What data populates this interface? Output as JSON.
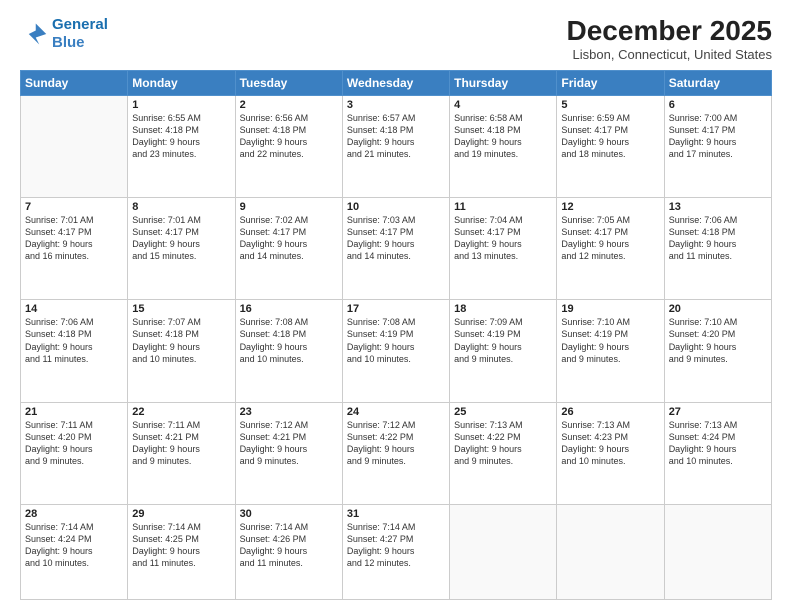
{
  "header": {
    "logo_line1": "General",
    "logo_line2": "Blue",
    "month": "December 2025",
    "location": "Lisbon, Connecticut, United States"
  },
  "weekdays": [
    "Sunday",
    "Monday",
    "Tuesday",
    "Wednesday",
    "Thursday",
    "Friday",
    "Saturday"
  ],
  "rows": [
    [
      {
        "num": "",
        "lines": []
      },
      {
        "num": "1",
        "lines": [
          "Sunrise: 6:55 AM",
          "Sunset: 4:18 PM",
          "Daylight: 9 hours",
          "and 23 minutes."
        ]
      },
      {
        "num": "2",
        "lines": [
          "Sunrise: 6:56 AM",
          "Sunset: 4:18 PM",
          "Daylight: 9 hours",
          "and 22 minutes."
        ]
      },
      {
        "num": "3",
        "lines": [
          "Sunrise: 6:57 AM",
          "Sunset: 4:18 PM",
          "Daylight: 9 hours",
          "and 21 minutes."
        ]
      },
      {
        "num": "4",
        "lines": [
          "Sunrise: 6:58 AM",
          "Sunset: 4:18 PM",
          "Daylight: 9 hours",
          "and 19 minutes."
        ]
      },
      {
        "num": "5",
        "lines": [
          "Sunrise: 6:59 AM",
          "Sunset: 4:17 PM",
          "Daylight: 9 hours",
          "and 18 minutes."
        ]
      },
      {
        "num": "6",
        "lines": [
          "Sunrise: 7:00 AM",
          "Sunset: 4:17 PM",
          "Daylight: 9 hours",
          "and 17 minutes."
        ]
      }
    ],
    [
      {
        "num": "7",
        "lines": [
          "Sunrise: 7:01 AM",
          "Sunset: 4:17 PM",
          "Daylight: 9 hours",
          "and 16 minutes."
        ]
      },
      {
        "num": "8",
        "lines": [
          "Sunrise: 7:01 AM",
          "Sunset: 4:17 PM",
          "Daylight: 9 hours",
          "and 15 minutes."
        ]
      },
      {
        "num": "9",
        "lines": [
          "Sunrise: 7:02 AM",
          "Sunset: 4:17 PM",
          "Daylight: 9 hours",
          "and 14 minutes."
        ]
      },
      {
        "num": "10",
        "lines": [
          "Sunrise: 7:03 AM",
          "Sunset: 4:17 PM",
          "Daylight: 9 hours",
          "and 14 minutes."
        ]
      },
      {
        "num": "11",
        "lines": [
          "Sunrise: 7:04 AM",
          "Sunset: 4:17 PM",
          "Daylight: 9 hours",
          "and 13 minutes."
        ]
      },
      {
        "num": "12",
        "lines": [
          "Sunrise: 7:05 AM",
          "Sunset: 4:17 PM",
          "Daylight: 9 hours",
          "and 12 minutes."
        ]
      },
      {
        "num": "13",
        "lines": [
          "Sunrise: 7:06 AM",
          "Sunset: 4:18 PM",
          "Daylight: 9 hours",
          "and 11 minutes."
        ]
      }
    ],
    [
      {
        "num": "14",
        "lines": [
          "Sunrise: 7:06 AM",
          "Sunset: 4:18 PM",
          "Daylight: 9 hours",
          "and 11 minutes."
        ]
      },
      {
        "num": "15",
        "lines": [
          "Sunrise: 7:07 AM",
          "Sunset: 4:18 PM",
          "Daylight: 9 hours",
          "and 10 minutes."
        ]
      },
      {
        "num": "16",
        "lines": [
          "Sunrise: 7:08 AM",
          "Sunset: 4:18 PM",
          "Daylight: 9 hours",
          "and 10 minutes."
        ]
      },
      {
        "num": "17",
        "lines": [
          "Sunrise: 7:08 AM",
          "Sunset: 4:19 PM",
          "Daylight: 9 hours",
          "and 10 minutes."
        ]
      },
      {
        "num": "18",
        "lines": [
          "Sunrise: 7:09 AM",
          "Sunset: 4:19 PM",
          "Daylight: 9 hours",
          "and 9 minutes."
        ]
      },
      {
        "num": "19",
        "lines": [
          "Sunrise: 7:10 AM",
          "Sunset: 4:19 PM",
          "Daylight: 9 hours",
          "and 9 minutes."
        ]
      },
      {
        "num": "20",
        "lines": [
          "Sunrise: 7:10 AM",
          "Sunset: 4:20 PM",
          "Daylight: 9 hours",
          "and 9 minutes."
        ]
      }
    ],
    [
      {
        "num": "21",
        "lines": [
          "Sunrise: 7:11 AM",
          "Sunset: 4:20 PM",
          "Daylight: 9 hours",
          "and 9 minutes."
        ]
      },
      {
        "num": "22",
        "lines": [
          "Sunrise: 7:11 AM",
          "Sunset: 4:21 PM",
          "Daylight: 9 hours",
          "and 9 minutes."
        ]
      },
      {
        "num": "23",
        "lines": [
          "Sunrise: 7:12 AM",
          "Sunset: 4:21 PM",
          "Daylight: 9 hours",
          "and 9 minutes."
        ]
      },
      {
        "num": "24",
        "lines": [
          "Sunrise: 7:12 AM",
          "Sunset: 4:22 PM",
          "Daylight: 9 hours",
          "and 9 minutes."
        ]
      },
      {
        "num": "25",
        "lines": [
          "Sunrise: 7:13 AM",
          "Sunset: 4:22 PM",
          "Daylight: 9 hours",
          "and 9 minutes."
        ]
      },
      {
        "num": "26",
        "lines": [
          "Sunrise: 7:13 AM",
          "Sunset: 4:23 PM",
          "Daylight: 9 hours",
          "and 10 minutes."
        ]
      },
      {
        "num": "27",
        "lines": [
          "Sunrise: 7:13 AM",
          "Sunset: 4:24 PM",
          "Daylight: 9 hours",
          "and 10 minutes."
        ]
      }
    ],
    [
      {
        "num": "28",
        "lines": [
          "Sunrise: 7:14 AM",
          "Sunset: 4:24 PM",
          "Daylight: 9 hours",
          "and 10 minutes."
        ]
      },
      {
        "num": "29",
        "lines": [
          "Sunrise: 7:14 AM",
          "Sunset: 4:25 PM",
          "Daylight: 9 hours",
          "and 11 minutes."
        ]
      },
      {
        "num": "30",
        "lines": [
          "Sunrise: 7:14 AM",
          "Sunset: 4:26 PM",
          "Daylight: 9 hours",
          "and 11 minutes."
        ]
      },
      {
        "num": "31",
        "lines": [
          "Sunrise: 7:14 AM",
          "Sunset: 4:27 PM",
          "Daylight: 9 hours",
          "and 12 minutes."
        ]
      },
      {
        "num": "",
        "lines": []
      },
      {
        "num": "",
        "lines": []
      },
      {
        "num": "",
        "lines": []
      }
    ]
  ]
}
